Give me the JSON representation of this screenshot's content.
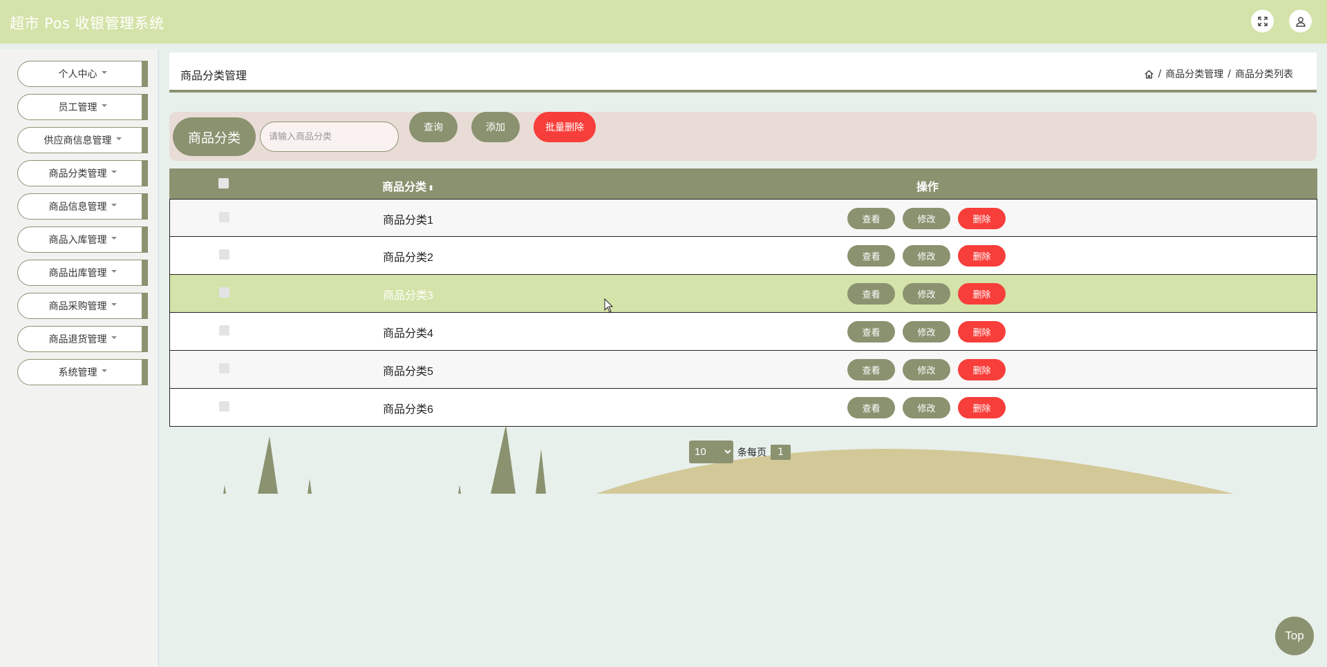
{
  "header": {
    "app_title": "超市 Pos 收银管理系统",
    "fullscreen_icon": "expand-icon",
    "user_icon": "user-icon"
  },
  "sidebar": {
    "items": [
      {
        "label": "个人中心"
      },
      {
        "label": "员工管理"
      },
      {
        "label": "供应商信息管理"
      },
      {
        "label": "商品分类管理"
      },
      {
        "label": "商品信息管理"
      },
      {
        "label": "商品入库管理"
      },
      {
        "label": "商品出库管理"
      },
      {
        "label": "商品采购管理"
      },
      {
        "label": "商品退货管理"
      },
      {
        "label": "系统管理"
      }
    ]
  },
  "page": {
    "title": "商品分类管理",
    "breadcrumb": {
      "home_icon": "home-icon",
      "sep": "/",
      "level1": "商品分类管理",
      "level2": "商品分类列表"
    }
  },
  "search": {
    "label": "商品分类",
    "placeholder": "请输入商品分类",
    "value": "",
    "query_label": "查询",
    "add_label": "添加",
    "batch_delete_label": "批量删除"
  },
  "table": {
    "headers": {
      "name": "商品分类",
      "sort_glyph": "⬍",
      "ops": "操作"
    },
    "rows": [
      {
        "name": "商品分类1",
        "view": "查看",
        "edit": "修改",
        "delete": "删除"
      },
      {
        "name": "商品分类2",
        "view": "查看",
        "edit": "修改",
        "delete": "删除"
      },
      {
        "name": "商品分类3",
        "view": "查看",
        "edit": "修改",
        "delete": "删除"
      },
      {
        "name": "商品分类4",
        "view": "查看",
        "edit": "修改",
        "delete": "删除"
      },
      {
        "name": "商品分类5",
        "view": "查看",
        "edit": "修改",
        "delete": "删除"
      },
      {
        "name": "商品分类6",
        "view": "查看",
        "edit": "修改",
        "delete": "删除"
      }
    ]
  },
  "pagination": {
    "page_size": "10",
    "per_page_text": "条每页",
    "current_page": "1"
  },
  "back_to_top": "Top",
  "colors": {
    "primary": "#8a9270",
    "header_bg": "#d4e3a9",
    "danger": "#f73e3a",
    "search_bg": "#e9dcd6",
    "hill": "#d3c998"
  }
}
